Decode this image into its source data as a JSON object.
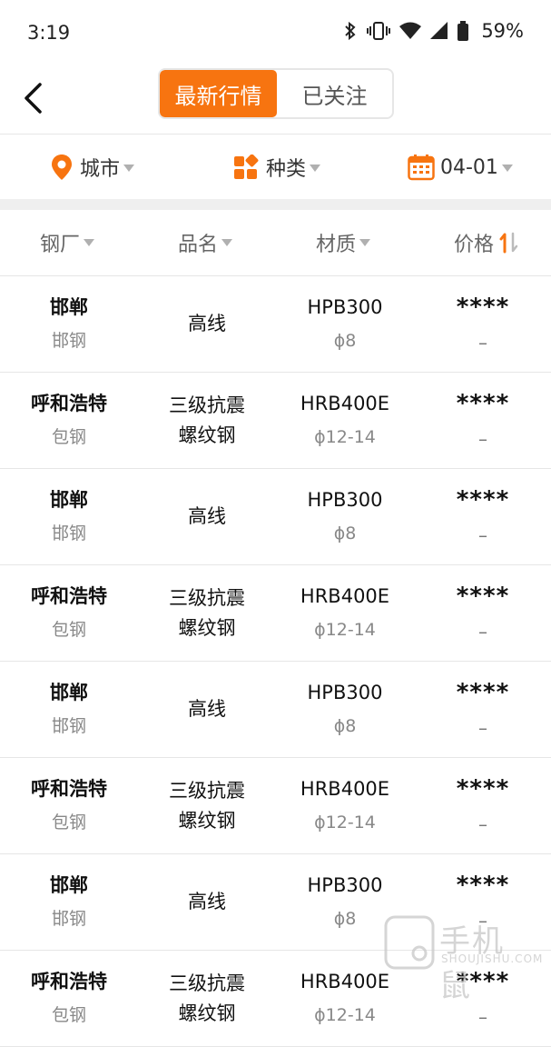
{
  "status": {
    "time": "3:19",
    "battery": "59%"
  },
  "tabs": {
    "active": "最新行情",
    "inactive": "已关注"
  },
  "filters": {
    "city": "城市",
    "category": "种类",
    "date": "04-01"
  },
  "columns": {
    "mill": "钢厂",
    "name": "品名",
    "material": "材质",
    "price": "价格"
  },
  "rows": [
    {
      "city": "邯郸",
      "mill": "邯钢",
      "name": "高线",
      "material": "HPB300",
      "spec": "ϕ8",
      "price": "****",
      "change": "–"
    },
    {
      "city": "呼和浩特",
      "mill": "包钢",
      "name": "三级抗震螺纹钢",
      "name_line1": "三级抗震",
      "name_line2": "螺纹钢",
      "material": "HRB400E",
      "spec": "ϕ12-14",
      "price": "****",
      "change": "–"
    },
    {
      "city": "邯郸",
      "mill": "邯钢",
      "name": "高线",
      "material": "HPB300",
      "spec": "ϕ8",
      "price": "****",
      "change": "–"
    },
    {
      "city": "呼和浩特",
      "mill": "包钢",
      "name": "三级抗震螺纹钢",
      "name_line1": "三级抗震",
      "name_line2": "螺纹钢",
      "material": "HRB400E",
      "spec": "ϕ12-14",
      "price": "****",
      "change": "–"
    },
    {
      "city": "邯郸",
      "mill": "邯钢",
      "name": "高线",
      "material": "HPB300",
      "spec": "ϕ8",
      "price": "****",
      "change": "–"
    },
    {
      "city": "呼和浩特",
      "mill": "包钢",
      "name": "三级抗震螺纹钢",
      "name_line1": "三级抗震",
      "name_line2": "螺纹钢",
      "material": "HRB400E",
      "spec": "ϕ12-14",
      "price": "****",
      "change": "–"
    },
    {
      "city": "邯郸",
      "mill": "邯钢",
      "name": "高线",
      "material": "HPB300",
      "spec": "ϕ8",
      "price": "****",
      "change": "–"
    },
    {
      "city": "呼和浩特",
      "mill": "包钢",
      "name": "三级抗震螺纹钢",
      "name_line1": "三级抗震",
      "name_line2": "螺纹钢",
      "material": "HRB400E",
      "spec": "ϕ12-14",
      "price": "****",
      "change": "–"
    }
  ],
  "watermark": {
    "text": "手机鼠",
    "sub": "SHOUJISHU.COM"
  },
  "colors": {
    "accent": "#f77410",
    "divider": "#e6e6e6"
  }
}
